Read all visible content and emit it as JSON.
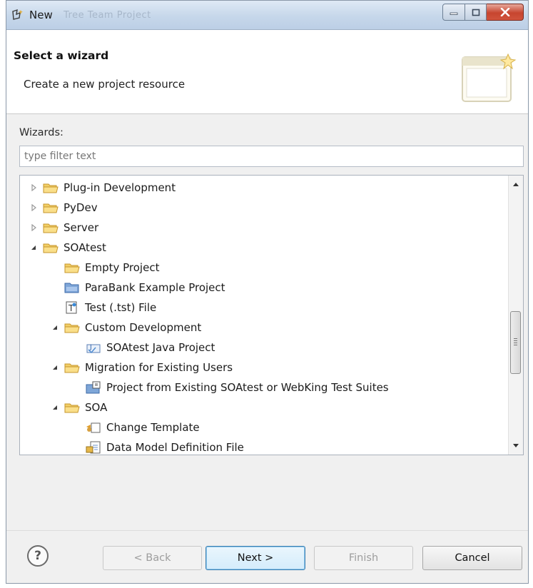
{
  "window": {
    "title": "New",
    "title_ghost": "Tree Team Project"
  },
  "header": {
    "title": "Select a wizard",
    "description": "Create a new project resource"
  },
  "wizards": {
    "label": "Wizards:",
    "filter_placeholder": "type filter text",
    "items": [
      {
        "label": "Plug-in Development",
        "level": 0,
        "expander": "collapsed",
        "icon": "folder-icon"
      },
      {
        "label": "PyDev",
        "level": 0,
        "expander": "collapsed",
        "icon": "folder-icon"
      },
      {
        "label": "Server",
        "level": 0,
        "expander": "collapsed",
        "icon": "folder-icon"
      },
      {
        "label": "SOAtest",
        "level": 0,
        "expander": "expanded",
        "icon": "folder-icon"
      },
      {
        "label": "Empty Project",
        "level": 1,
        "expander": "none",
        "icon": "folder-icon"
      },
      {
        "label": "ParaBank Example Project",
        "level": 1,
        "expander": "none",
        "icon": "project-icon"
      },
      {
        "label": "Test (.tst) File",
        "level": 1,
        "expander": "none",
        "icon": "test-file-icon"
      },
      {
        "label": "Custom Development",
        "level": 1,
        "expander": "expanded",
        "icon": "folder-icon"
      },
      {
        "label": "SOAtest Java Project",
        "level": 2,
        "expander": "none",
        "icon": "java-project-icon"
      },
      {
        "label": "Migration for Existing Users",
        "level": 1,
        "expander": "expanded",
        "icon": "folder-icon"
      },
      {
        "label": "Project from Existing SOAtest or WebKing Test Suites",
        "level": 2,
        "expander": "none",
        "icon": "import-project-icon"
      },
      {
        "label": "SOA",
        "level": 1,
        "expander": "expanded",
        "icon": "folder-icon"
      },
      {
        "label": "Change Template",
        "level": 2,
        "expander": "none",
        "icon": "template-icon"
      },
      {
        "label": "Data Model Definition File",
        "level": 2,
        "expander": "none",
        "icon": "data-model-icon"
      }
    ]
  },
  "buttons": {
    "help": "?",
    "back": "< Back",
    "next": "Next >",
    "finish": "Finish",
    "cancel": "Cancel"
  }
}
